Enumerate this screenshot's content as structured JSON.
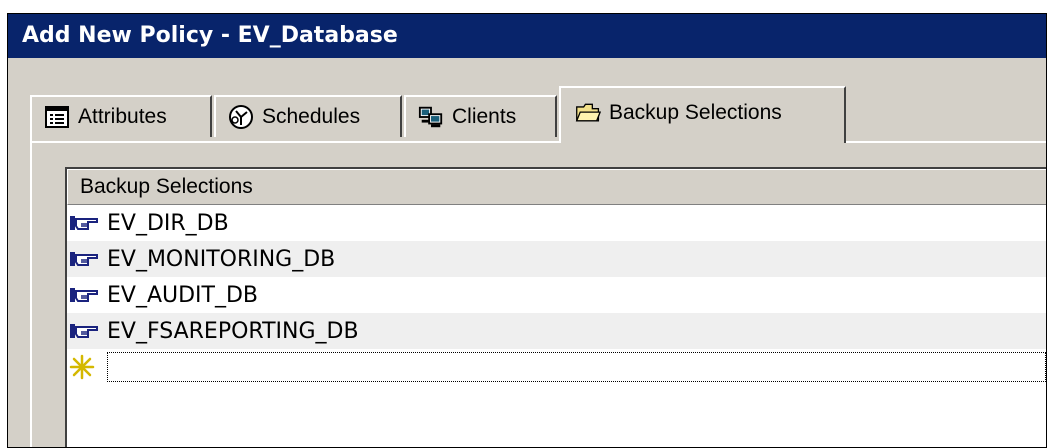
{
  "window": {
    "title": "Add New Policy - EV_Database"
  },
  "tabs": [
    {
      "label": "Attributes",
      "icon": "attributes-icon"
    },
    {
      "label": "Schedules",
      "icon": "schedules-icon"
    },
    {
      "label": "Clients",
      "icon": "clients-icon"
    },
    {
      "label": "Backup Selections",
      "icon": "folder-icon",
      "active": true
    }
  ],
  "list": {
    "column_header": "Backup Selections",
    "rows": [
      {
        "label": "EV_DIR_DB",
        "icon": "directive-hand-icon"
      },
      {
        "label": "EV_MONITORING_DB",
        "icon": "directive-hand-icon"
      },
      {
        "label": "EV_AUDIT_DB",
        "icon": "directive-hand-icon"
      },
      {
        "label": "EV_FSAREPORTING_DB",
        "icon": "directive-hand-icon"
      }
    ],
    "new_row_icon": "new-item-star-icon"
  }
}
